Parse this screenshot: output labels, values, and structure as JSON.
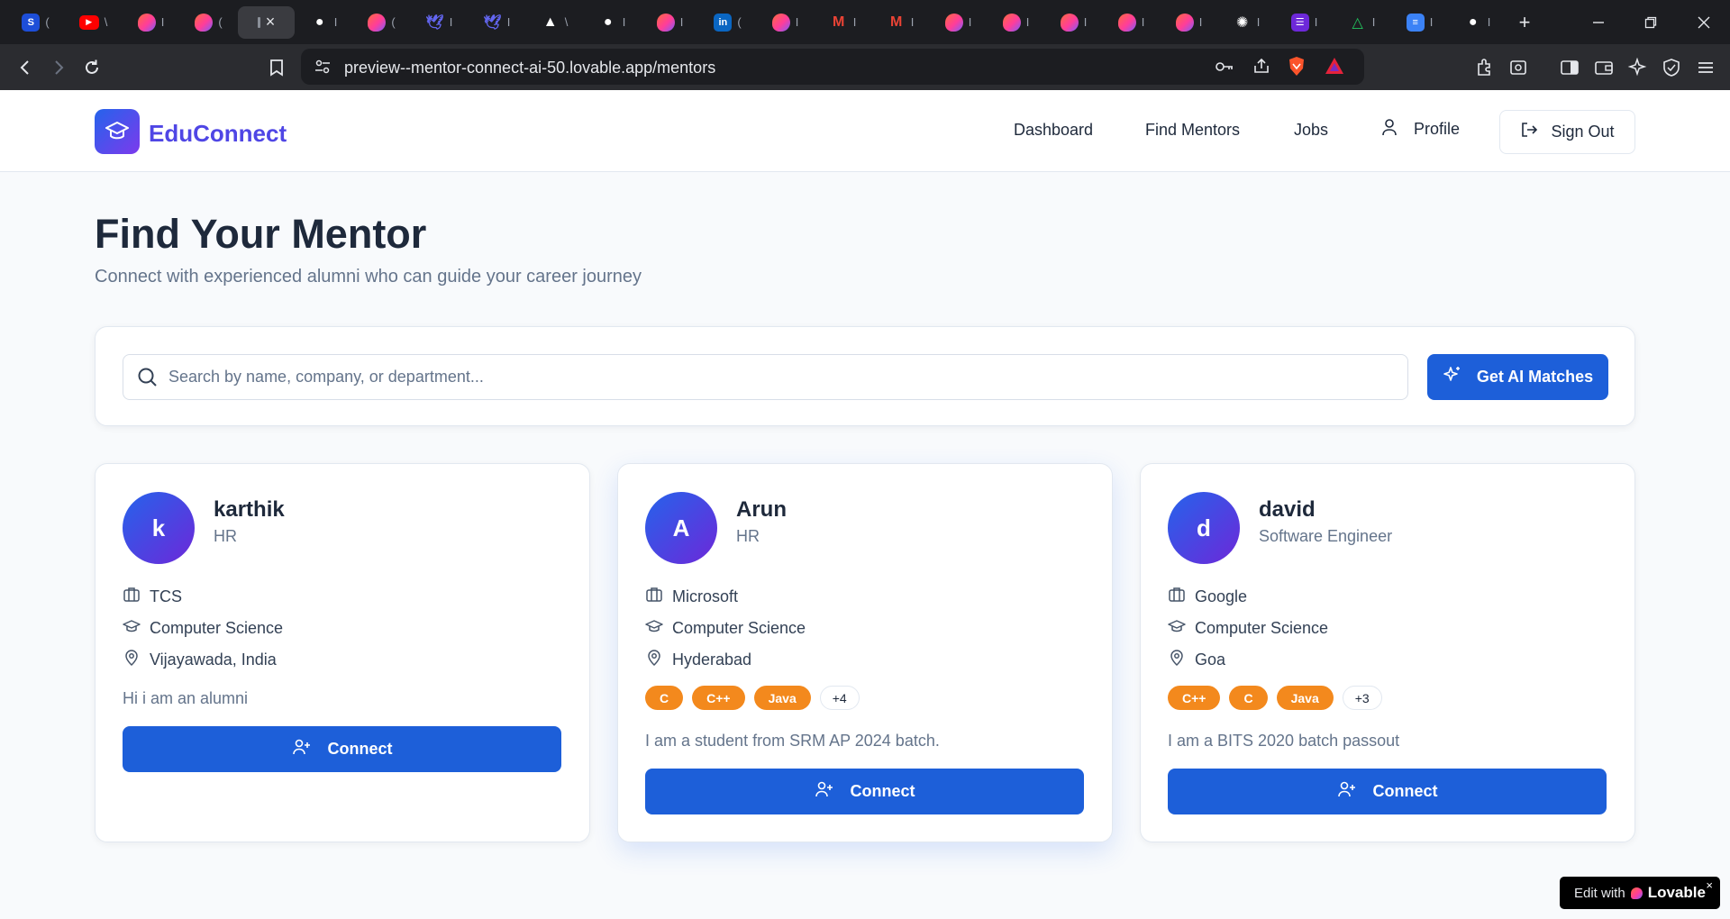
{
  "browser": {
    "tabs": [
      {
        "icon": "s-app-icon",
        "glyph": "S",
        "color": "#1d4ed8",
        "sep": "("
      },
      {
        "icon": "youtube-icon",
        "glyph": "▶",
        "color": "#ff0000",
        "sep": "\\"
      },
      {
        "icon": "lovable-icon",
        "glyph": "",
        "color": "",
        "sep": "I"
      },
      {
        "icon": "lovable-icon",
        "glyph": "",
        "color": "",
        "sep": "("
      },
      {
        "icon": "active-tab",
        "glyph": "",
        "color": "",
        "sep": "",
        "active": true
      },
      {
        "icon": "github-icon",
        "glyph": "●",
        "color": "#ffffff",
        "sep": "I"
      },
      {
        "icon": "lovable-icon",
        "glyph": "",
        "color": "",
        "sep": "("
      },
      {
        "icon": "bird-icon",
        "glyph": "🕊",
        "color": "#6366f1",
        "sep": "I"
      },
      {
        "icon": "bird-icon",
        "glyph": "🕊",
        "color": "#6366f1",
        "sep": "I"
      },
      {
        "icon": "triangle-icon",
        "glyph": "▲",
        "color": "#ffffff",
        "sep": "\\"
      },
      {
        "icon": "github-icon",
        "glyph": "●",
        "color": "#ffffff",
        "sep": "I"
      },
      {
        "icon": "lovable-icon",
        "glyph": "",
        "color": "",
        "sep": "I"
      },
      {
        "icon": "linkedin-icon",
        "glyph": "in",
        "color": "#0a66c2",
        "sep": "("
      },
      {
        "icon": "lovable-icon",
        "glyph": "",
        "color": "",
        "sep": "I"
      },
      {
        "icon": "gmail-icon",
        "glyph": "M",
        "color": "#ea4335",
        "sep": "I"
      },
      {
        "icon": "gmail-icon",
        "glyph": "M",
        "color": "#ea4335",
        "sep": "I"
      },
      {
        "icon": "lovable-icon",
        "glyph": "",
        "color": "",
        "sep": "I"
      },
      {
        "icon": "lovable-icon",
        "glyph": "",
        "color": "",
        "sep": "I"
      },
      {
        "icon": "lovable-icon",
        "glyph": "",
        "color": "",
        "sep": "I"
      },
      {
        "icon": "lovable-icon",
        "glyph": "",
        "color": "",
        "sep": "I"
      },
      {
        "icon": "lovable-icon",
        "glyph": "",
        "color": "",
        "sep": "I"
      },
      {
        "icon": "openai-icon",
        "glyph": "✺",
        "color": "#ffffff",
        "sep": "I"
      },
      {
        "icon": "list-app-icon",
        "glyph": "☰",
        "color": "#6d28d9",
        "sep": "I"
      },
      {
        "icon": "drive-icon",
        "glyph": "△",
        "color": "#22c55e",
        "sep": "I"
      },
      {
        "icon": "docs-icon",
        "glyph": "≡",
        "color": "#3b82f6",
        "sep": "I"
      },
      {
        "icon": "github-icon",
        "glyph": "●",
        "color": "#ffffff",
        "sep": "I"
      }
    ],
    "new_tab": "+",
    "url": "preview--mentor-connect-ai-50.lovable.app/mentors"
  },
  "header": {
    "brand": "EduConnect",
    "nav": {
      "dashboard": "Dashboard",
      "find_mentors": "Find Mentors",
      "jobs": "Jobs",
      "profile": "Profile",
      "sign_out": "Sign Out"
    }
  },
  "main": {
    "title": "Find Your Mentor",
    "subtitle": "Connect with experienced alumni who can guide your career journey",
    "search": {
      "placeholder": "Search by name, company, or department...",
      "value": ""
    },
    "ai_button": "Get AI Matches"
  },
  "mentors": [
    {
      "initial": "k",
      "name": "karthik",
      "role": "HR",
      "company": "TCS",
      "department": "Computer Science",
      "location": "Vijayawada, India",
      "skills": [],
      "more": "",
      "bio": "Hi i am an alumni",
      "connect": "Connect"
    },
    {
      "initial": "A",
      "name": "Arun",
      "role": "HR",
      "company": "Microsoft",
      "department": "Computer Science",
      "location": "Hyderabad",
      "skills": [
        "C",
        "C++",
        "Java"
      ],
      "more": "+4",
      "bio": "I am a student from SRM AP 2024 batch.",
      "connect": "Connect"
    },
    {
      "initial": "d",
      "name": "david",
      "role": "Software Engineer",
      "company": "Google",
      "department": "Computer Science",
      "location": "Goa",
      "skills": [
        "C++",
        "C",
        "Java"
      ],
      "more": "+3",
      "bio": "I am a BITS 2020 batch passout",
      "connect": "Connect"
    }
  ],
  "badge": {
    "prefix": "Edit with",
    "brand": "Lovable",
    "close": "×"
  },
  "colors": {
    "primary": "#1d5fd9",
    "brand_text": "#4f46e5",
    "skill_chip": "#f3891d",
    "page_bg": "#f8fafc"
  }
}
